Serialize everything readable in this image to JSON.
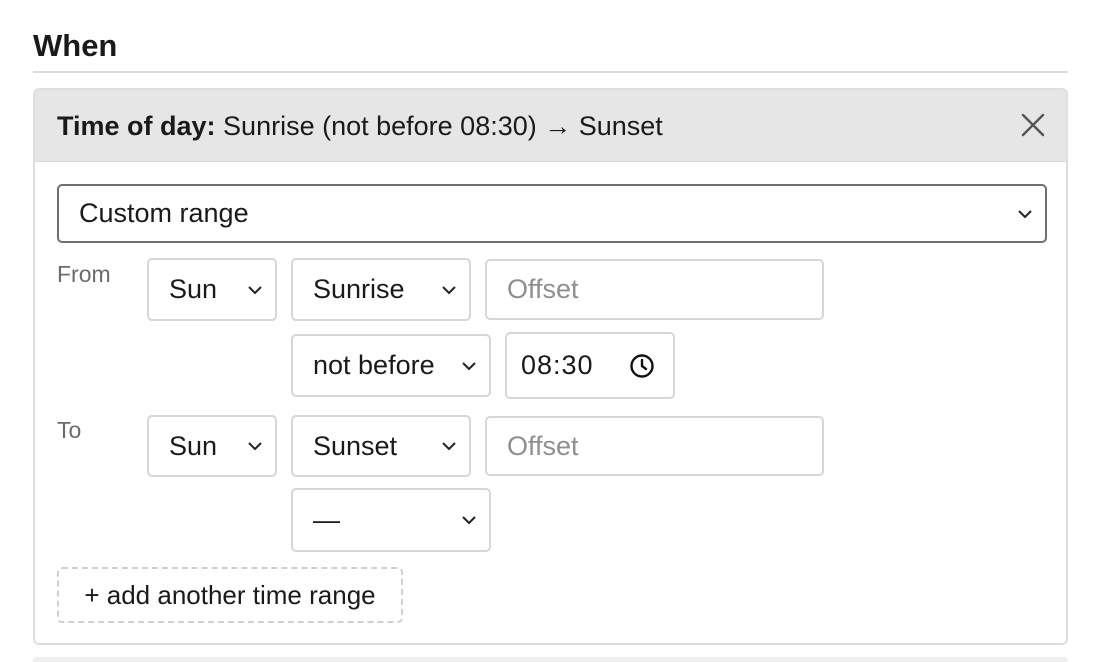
{
  "section": {
    "title": "When"
  },
  "card": {
    "header_label": "Time of day:",
    "header_value": " Sunrise (not before 08:30) → Sunset",
    "mode_select": {
      "value": "Custom range"
    },
    "from": {
      "label": "From",
      "day": "Sun",
      "event": "Sunrise",
      "offset_placeholder": "Offset",
      "constraint": "not before",
      "time": "08:30"
    },
    "to": {
      "label": "To",
      "day": "Sun",
      "event": "Sunset",
      "offset_placeholder": "Offset",
      "constraint": "—"
    },
    "add_range_label": "+ add another time range"
  },
  "icons": {
    "close": "close-icon",
    "chevron": "chevron-down-icon",
    "clock": "clock-icon"
  }
}
